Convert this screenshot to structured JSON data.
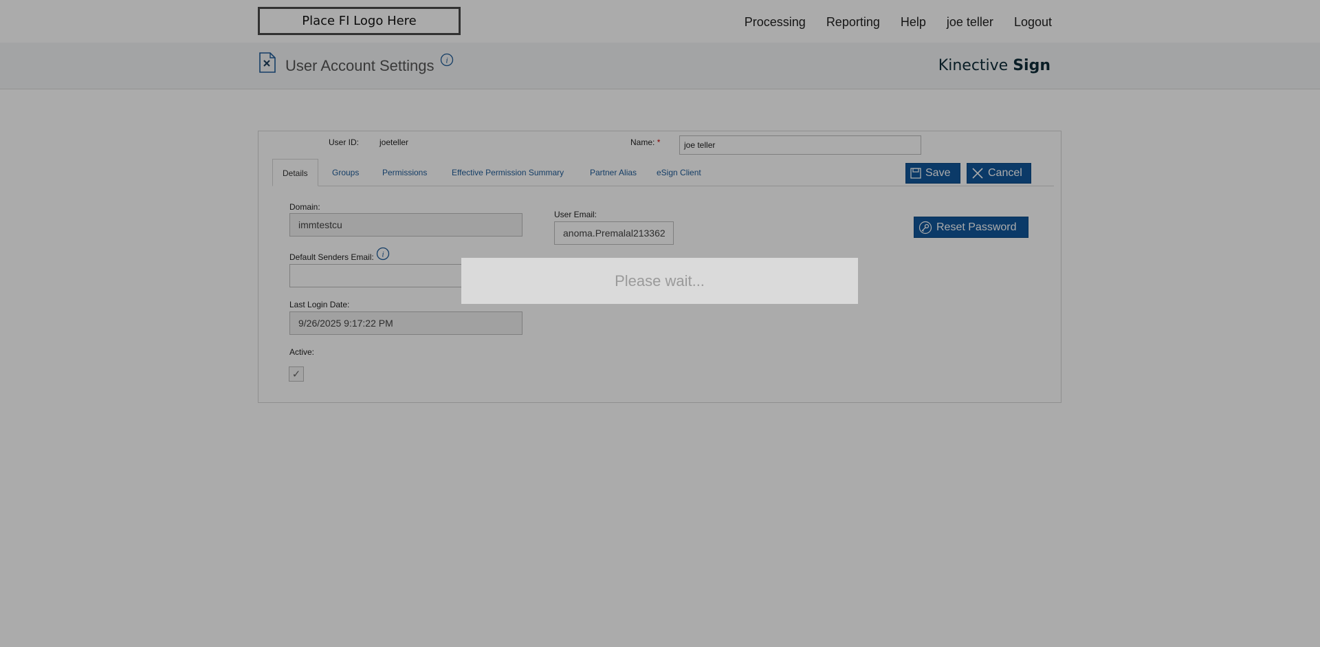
{
  "header": {
    "logo_text": "Place FI Logo Here",
    "nav": [
      "Processing",
      "Reporting",
      "Help",
      "joe teller",
      "Logout"
    ]
  },
  "subheader": {
    "title": "User Account Settings",
    "brand_regular": "Kinective",
    "brand_bold": "Sign",
    "icons": [
      "document-settings-icon",
      "info-icon"
    ]
  },
  "form": {
    "user_id_label": "User ID:",
    "user_id_value": "joeteller",
    "name_label": "Name:",
    "required_mark": "*",
    "name_value": "joe teller",
    "tabs": [
      "Details",
      "Groups",
      "Permissions",
      "Effective Permission Summary",
      "Partner Alias",
      "eSign Client"
    ],
    "active_tab": "Details",
    "save_label": "Save",
    "cancel_label": "Cancel",
    "reset_password_label": "Reset Password",
    "domain_label": "Domain:",
    "domain_value": "immtestcu",
    "user_email_label": "User Email:",
    "user_email_value": "anoma.Premalal213362",
    "default_senders_email_label": "Default Senders Email:",
    "default_senders_email_value": "",
    "last_login_label": "Last Login Date:",
    "last_login_value": "9/26/2025 9:17:22 PM",
    "active_label": "Active:",
    "active_checked": true
  },
  "overlay": {
    "message": "Please wait..."
  },
  "colors": {
    "accent": "#11579b",
    "link": "#1e5c99",
    "brand": "#0f2d3a"
  }
}
